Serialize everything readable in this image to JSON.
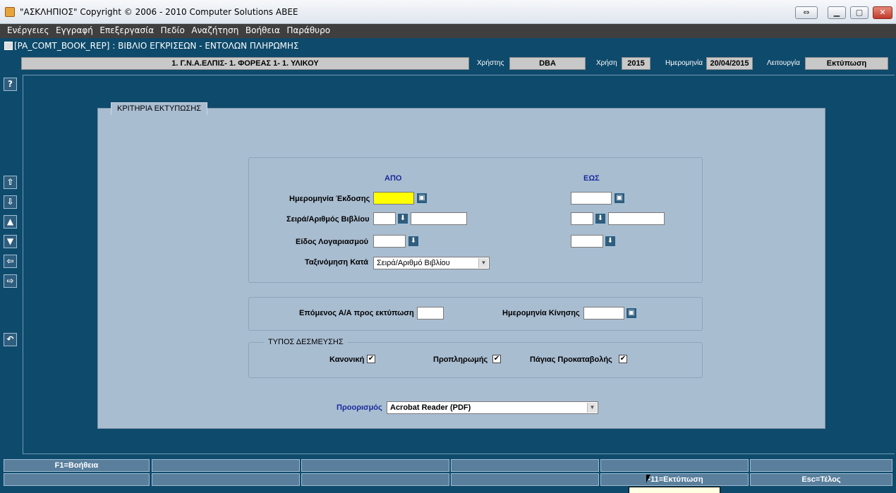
{
  "window": {
    "title": "\"ΑΣΚΛΗΠΙΟΣ\" Copyright © 2006 - 2010 Computer Solutions ABEE",
    "restore_label": "⇔",
    "minimize_label": "▁",
    "maximize_label": "▢",
    "close_label": "✕"
  },
  "menu": [
    "Ενέργειες",
    "Εγγραφή",
    "Επεξεργασία",
    "Πεδίο",
    "Αναζήτηση",
    "Βοήθεια",
    "Παράθυρο"
  ],
  "form": {
    "title": "[PA_COMT_BOOK_REP]  :  ΒΙΒΛΙΟ ΕΓΚΡΙΣΕΩΝ - ΕΝΤΟΛΩΝ ΠΛΗΡΩΜΗΣ"
  },
  "info": {
    "organization": "1. Γ.Ν.Α.ΕΛΠΙΣ- 1. ΦΟΡΕΑΣ 1- 1. ΥΛΙΚΟΥ",
    "user_label": "Χρήστης",
    "user": "DBA",
    "year_label": "Χρήση",
    "year": "2015",
    "date_label": "Ημερομηνία",
    "date": "20/04/2015",
    "function_label": "Λειτουργία",
    "function": "Εκτύπωση"
  },
  "left_toolbar": [
    "?",
    "⇧",
    "⇩",
    "▲",
    "▼",
    "⇦",
    "⇨",
    "↶"
  ],
  "criteria": {
    "tab_title": "ΚΡΙΤΗΡΙΑ ΕΚΤΥΠΩΣΗΣ",
    "from_header": "ΑΠΟ",
    "to_header": "ΕΩΣ",
    "issue_date_label": "Ημερομηνία Έκδοσης",
    "series_book_label": "Σειρά/Αριθμός Βιβλίου",
    "account_type_label": "Είδος Λογαριασμού",
    "sort_by_label": "Ταξινόμηση Κατά",
    "sort_by_value": "Σειρά/Αριθμό Βιβλίου",
    "next_aa_label": "Επόμενος Α/Α προς εκτύπωση",
    "movement_date_label": "Ημερομηνία Κίνησης",
    "commitment_group_title": "ΤΥΠΟΣ ΔΕΣΜΕΥΣΗΣ",
    "normal_label": "Κανονική",
    "prepayment_label": "Προπληρωμής",
    "fixed_advance_label": "Πάγιας Προκαταβολής",
    "normal_checked": true,
    "prepayment_checked": true,
    "fixed_advance_checked": true,
    "destination_label": "Προορισμός",
    "destination_value": "Acrobat Reader (PDF)"
  },
  "function_keys": {
    "row1": [
      "F1=Βοήθεια",
      "",
      "",
      "",
      "",
      ""
    ],
    "row2": [
      "",
      "",
      "",
      "",
      "F11=Εκτύπωση",
      "Esc=Τέλος"
    ]
  }
}
